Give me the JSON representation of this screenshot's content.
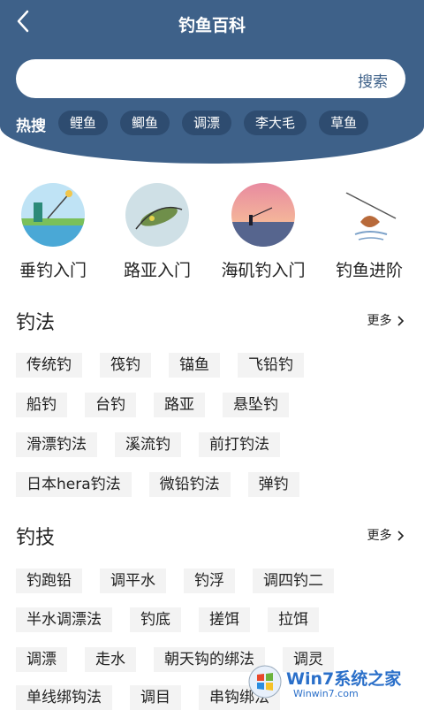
{
  "header": {
    "title": "钓鱼百科",
    "back_icon": "chevron-left-icon"
  },
  "search": {
    "placeholder": "",
    "button_label": "搜索"
  },
  "hot": {
    "label": "热搜",
    "tags": [
      "鲤鱼",
      "鲫鱼",
      "调漂",
      "李大毛",
      "草鱼"
    ]
  },
  "categories": [
    {
      "label": "垂钓入门"
    },
    {
      "label": "路亚入门"
    },
    {
      "label": "海矶钓入门"
    },
    {
      "label": "钓鱼进阶"
    }
  ],
  "sections": [
    {
      "title": "钓法",
      "more": "更多",
      "rows": [
        [
          "传统钓",
          "筏钓",
          "锚鱼",
          "飞铅钓"
        ],
        [
          "船钓",
          "台钓",
          "路亚",
          "悬坠钓"
        ],
        [
          "滑漂钓法",
          "溪流钓",
          "前打钓法"
        ],
        [
          "日本hera钓法",
          "微铅钓法",
          "弹钓"
        ]
      ]
    },
    {
      "title": "钓技",
      "more": "更多",
      "rows": [
        [
          "钓跑铅",
          "调平水",
          "钓浮",
          "调四钓二"
        ],
        [
          "半水调漂法",
          "钓底",
          "搓饵",
          "拉饵"
        ],
        [
          "调漂",
          "走水",
          "朝天钩的绑法",
          "调灵"
        ],
        [
          "单线绑钩法",
          "调目",
          "串钩绑法"
        ]
      ]
    }
  ],
  "watermark": {
    "brand": "Win7系统之家",
    "url": "Winwin7.com"
  },
  "colors": {
    "header_bg": "#3e6189",
    "hot_tag_bg": "#2e4c70",
    "tag_bg": "#f3f3f3"
  }
}
